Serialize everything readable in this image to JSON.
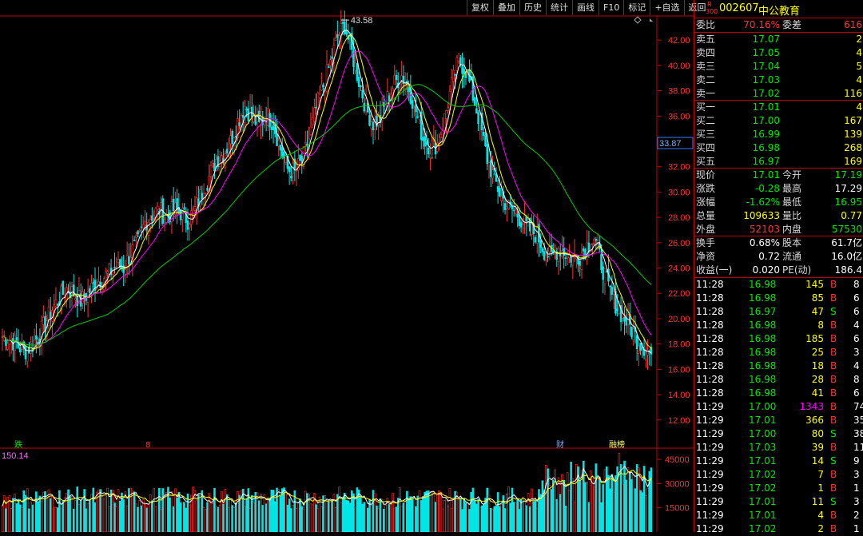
{
  "toolbar": [
    "复权",
    "叠加",
    "历史",
    "统计",
    "画线",
    "F10",
    "标记",
    "+自选",
    "返回"
  ],
  "stock": {
    "badge_top": "R",
    "badge_bottom": "300",
    "code": "002607",
    "name": "中公教育"
  },
  "wb": {
    "label1": "委比",
    "value1": "70.16%",
    "label2": "委差",
    "value2": "616"
  },
  "asks": [
    {
      "label": "卖五",
      "price": "17.07",
      "vol": "2"
    },
    {
      "label": "卖四",
      "price": "17.05",
      "vol": "4"
    },
    {
      "label": "卖三",
      "price": "17.04",
      "vol": "5"
    },
    {
      "label": "卖二",
      "price": "17.03",
      "vol": "4"
    },
    {
      "label": "卖一",
      "price": "17.02",
      "vol": "116"
    }
  ],
  "bids": [
    {
      "label": "买一",
      "price": "17.01",
      "vol": "4"
    },
    {
      "label": "买二",
      "price": "17.00",
      "vol": "167"
    },
    {
      "label": "买三",
      "price": "16.99",
      "vol": "139"
    },
    {
      "label": "买四",
      "price": "16.98",
      "vol": "268"
    },
    {
      "label": "买五",
      "price": "16.97",
      "vol": "169"
    }
  ],
  "quote": [
    {
      "l1": "现价",
      "v1": "17.01",
      "c1": "grn",
      "l2": "今开",
      "v2": "17.19",
      "c2": "grn"
    },
    {
      "l1": "涨跌",
      "v1": "-0.28",
      "c1": "grn",
      "l2": "最高",
      "v2": "17.29",
      "c2": "wht"
    },
    {
      "l1": "涨幅",
      "v1": "-1.62%",
      "c1": "grn",
      "l2": "最低",
      "v2": "16.95",
      "c2": "grn"
    },
    {
      "l1": "总量",
      "v1": "109633",
      "c1": "yel",
      "l2": "量比",
      "v2": "0.77",
      "c2": "yel"
    },
    {
      "l1": "外盘",
      "v1": "52103",
      "c1": "red",
      "l2": "内盘",
      "v2": "57530",
      "c2": "grn"
    }
  ],
  "fund": [
    {
      "l1": "换手",
      "v1": "0.68%",
      "l2": "股本",
      "v2": "61.7亿"
    },
    {
      "l1": "净资",
      "v1": "0.72",
      "l2": "流通",
      "v2": "16.0亿"
    },
    {
      "l1": "收益(一)",
      "v1": "0.020",
      "l2": "PE(动)",
      "v2": "186.4"
    }
  ],
  "ticks": [
    {
      "t": "11:28",
      "p": "16.98",
      "v": "145",
      "s": "B",
      "n": "8"
    },
    {
      "t": "11:28",
      "p": "16.98",
      "v": "85",
      "s": "B",
      "n": "6"
    },
    {
      "t": "11:28",
      "p": "16.97",
      "v": "47",
      "s": "S",
      "n": "6"
    },
    {
      "t": "11:28",
      "p": "16.98",
      "v": "8",
      "s": "B",
      "n": "4"
    },
    {
      "t": "11:28",
      "p": "16.98",
      "v": "185",
      "s": "B",
      "n": "6"
    },
    {
      "t": "11:28",
      "p": "16.98",
      "v": "25",
      "s": "B",
      "n": "3"
    },
    {
      "t": "11:28",
      "p": "16.98",
      "v": "18",
      "s": "B",
      "n": "4"
    },
    {
      "t": "11:28",
      "p": "16.98",
      "v": "28",
      "s": "B",
      "n": "8"
    },
    {
      "t": "11:28",
      "p": "16.98",
      "v": "41",
      "s": "B",
      "n": "6"
    },
    {
      "t": "11:29",
      "p": "17.00",
      "v": "1343",
      "s": "B",
      "n": "74"
    },
    {
      "t": "11:29",
      "p": "17.01",
      "v": "366",
      "s": "B",
      "n": "35"
    },
    {
      "t": "11:29",
      "p": "17.00",
      "v": "80",
      "s": "S",
      "n": "38"
    },
    {
      "t": "11:29",
      "p": "17.03",
      "v": "39",
      "s": "B",
      "n": "11"
    },
    {
      "t": "11:29",
      "p": "17.01",
      "v": "14",
      "s": "S",
      "n": "9"
    },
    {
      "t": "11:29",
      "p": "17.02",
      "v": "7",
      "s": "B",
      "n": "3"
    },
    {
      "t": "11:29",
      "p": "17.02",
      "v": "1",
      "s": "B",
      "n": "1"
    },
    {
      "t": "11:29",
      "p": "17.01",
      "v": "11",
      "s": "S",
      "n": "3"
    },
    {
      "t": "11:29",
      "p": "17.01",
      "v": "4",
      "s": "B",
      "n": "2"
    },
    {
      "t": "11:29",
      "p": "17.02",
      "v": "2",
      "s": "B",
      "n": "1"
    }
  ],
  "chart": {
    "price_ticks": [
      "42.00",
      "40.00",
      "38.00",
      "36.00",
      "34.00",
      "32.00",
      "30.00",
      "28.00",
      "26.00",
      "24.00",
      "22.00",
      "20.00",
      "18.00",
      "16.00",
      "14.00",
      "12.00"
    ],
    "price_range": [
      10.6,
      43.9
    ],
    "current_price": "33.87",
    "current_price_value": 33.87,
    "high_label": "43.58",
    "high_value": 43.58,
    "vol_ticks": [
      "45000",
      "30000",
      "15000"
    ],
    "vol_range": [
      0,
      50000
    ],
    "vol_label": "150.14",
    "markers": [
      {
        "text": "跌",
        "color": "#00e600"
      },
      {
        "text": "8",
        "color": "#ff3232"
      },
      {
        "text": "财",
        "color": "#7db3ff"
      },
      {
        "text": "融榜",
        "color": "#ffff66"
      }
    ],
    "closes": [
      18.6,
      18.4,
      18.0,
      17.4,
      17.8,
      18.6,
      19.6,
      20.8,
      21.6,
      22.4,
      22.0,
      21.4,
      22.0,
      22.8,
      23.2,
      23.6,
      24.2,
      24.0,
      25.2,
      26.0,
      27.6,
      28.2,
      28.6,
      28.0,
      28.6,
      28.4,
      27.8,
      28.6,
      30.0,
      31.2,
      32.6,
      33.0,
      34.0,
      35.6,
      36.8,
      36.0,
      35.2,
      36.2,
      35.4,
      33.4,
      31.8,
      31.6,
      32.4,
      34.2,
      36.6,
      38.4,
      40.2,
      42.2,
      43.2,
      41.0,
      38.8,
      36.6,
      35.4,
      35.8,
      37.4,
      38.6,
      39.2,
      38.2,
      36.4,
      34.2,
      33.6,
      33.8,
      35.8,
      38.4,
      40.4,
      39.6,
      37.6,
      35.4,
      32.6,
      31.0,
      29.6,
      28.8,
      28.4,
      27.6,
      27.0,
      26.6,
      25.4,
      24.8,
      25.6,
      25.2,
      24.8,
      25.0,
      25.8,
      26.4,
      24.4,
      22.4,
      21.2,
      20.2,
      19.4,
      18.4,
      17.8,
      17.2
    ]
  }
}
